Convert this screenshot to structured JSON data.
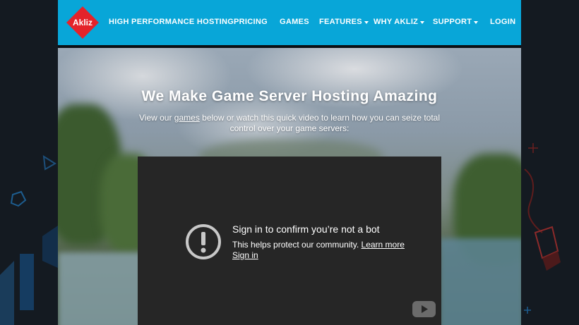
{
  "brand": {
    "name": "Akliz",
    "logo_color": "#e4232a"
  },
  "nav": {
    "items": [
      {
        "label": "HIGH PERFORMANCE HOSTING",
        "dropdown": false
      },
      {
        "label": "PRICING",
        "dropdown": false
      },
      {
        "label": "GAMES",
        "dropdown": false
      },
      {
        "label": "FEATURES",
        "dropdown": true
      },
      {
        "label": "WHY AKLIZ",
        "dropdown": true
      },
      {
        "label": "SUPPORT",
        "dropdown": true
      },
      {
        "label": "LOGIN",
        "dropdown": false
      }
    ]
  },
  "hero": {
    "title": "We Make Game Server Hosting Amazing",
    "subtitle_before": "View our ",
    "subtitle_link": "games",
    "subtitle_after": " below or watch this quick video to learn how you can seize total control over your game servers:"
  },
  "video": {
    "message_title": "Sign in to confirm you’re not a bot",
    "message_body": "This helps protect our community.",
    "learn_more": "Learn more",
    "sign_in": "Sign in",
    "icons": {
      "alert": "exclamation-circle-icon",
      "player": "youtube-logo-icon"
    }
  },
  "colors": {
    "header": "#08a6d8",
    "video_bg": "#262626",
    "page_bg": "#141a21"
  }
}
